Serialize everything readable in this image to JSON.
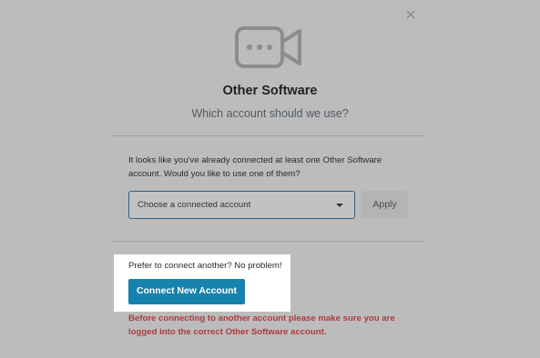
{
  "modal": {
    "close_icon": "close-icon",
    "logo_icon": "video-camera-icon",
    "title": "Other Software",
    "subtitle": "Which account should we use?"
  },
  "existing": {
    "intro": "It looks like you've already connected at least one Other Software account. Would you like to use one of them?",
    "select_value": "Choose a connected account",
    "apply_label": "Apply"
  },
  "new_account": {
    "prompt": "Prefer to connect another? No problem!",
    "connect_label": "Connect New Account",
    "warning": "Before connecting to another account please make sure you are logged into the correct Other Software account."
  },
  "colors": {
    "primary_button": "#1782ad",
    "warning_text": "#ad3b3b",
    "overlay": "#bcbcbc"
  }
}
